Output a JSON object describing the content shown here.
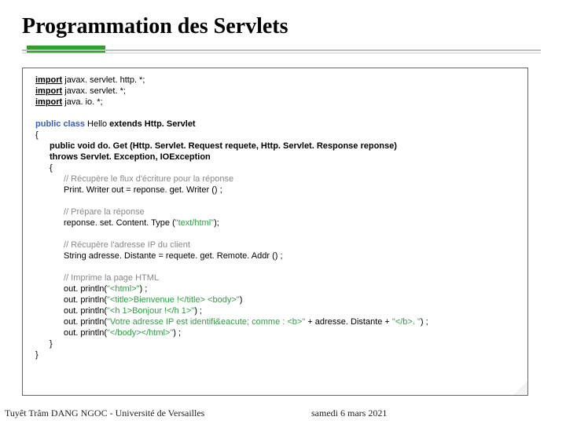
{
  "title": "Programmation des Servlets",
  "footer": {
    "author": "Tuyêt Trâm DANG NGOC - Université de Versailles",
    "date": "samedi 6 mars 2021"
  },
  "code": {
    "imp1a": "import",
    "imp1b": " javax. servlet. http. *;",
    "imp2a": "import",
    "imp2b": " javax. servlet. *;",
    "imp3a": "import",
    "imp3b": " java. io. *;",
    "cls1a": "public class",
    "cls1b": " Hello ",
    "cls1c": "extends",
    "cls1d": " Http. Servlet",
    "brace_open": "{",
    "m1a": "public void",
    "m1b": " do. Get (Http. Servlet. Request requete, Http. Servlet. Response reponse)",
    "m2a": "throws",
    "m2b": " Servlet. Exception, IOException",
    "brace_open2": "{",
    "c1": "// Récupère le flux d'écriture pour la réponse",
    "l1": "Print. Writer out = reponse. get. Writer () ;",
    "c2": "// Prépare la réponse",
    "l2a": "reponse. set. Content. Type (",
    "l2b": "\"text/html\"",
    "l2c": ");",
    "c3": "// Récupère l'adresse IP du client",
    "l3": "String adresse. Distante = requete. get. Remote. Addr () ;",
    "c4": "// Imprime la page HTML",
    "p1a": "out. println(",
    "p1b": "\"<html>\"",
    "p1c": ") ;",
    "p2a": "out. println(",
    "p2b": "\"<title>Bienvenue !</title> <body>\"",
    "p2c": ")",
    "p3a": "out. println(",
    "p3b": "\"<h 1>Bonjour !</h 1>\"",
    "p3c": ") ;",
    "p4a": "out. println(",
    "p4b": "\"Votre adresse IP est identifi&eacute; comme : <b>\"",
    "p4c": " + adresse. Distante + ",
    "p4d": "\"</b>. \"",
    "p4e": ") ;",
    "p5a": "out. println(",
    "p5b": "\"</body></html>\"",
    "p5c": ") ;",
    "brace_close2": "}",
    "brace_close": "}"
  }
}
